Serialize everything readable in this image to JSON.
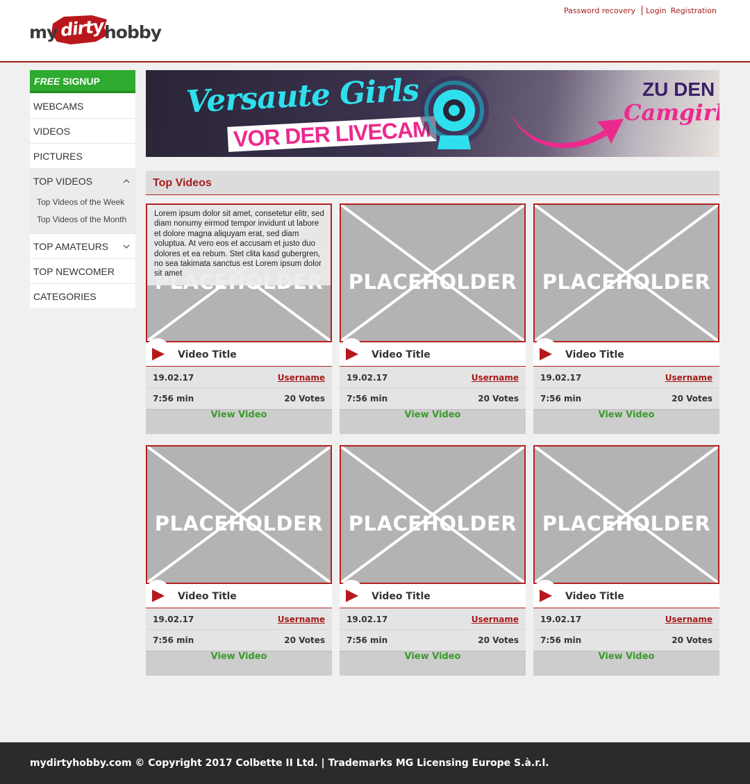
{
  "header": {
    "logo": {
      "part1": "my",
      "part2": "dirty",
      "part3": "hobby"
    },
    "links": {
      "password_recovery": "Password recovery",
      "login": "Login",
      "registration": "Registration"
    }
  },
  "sidebar": {
    "signup": {
      "free": "FREE",
      "signup": "SIGNUP"
    },
    "items": [
      {
        "label": "WEBCAMS"
      },
      {
        "label": "VIDEOS"
      },
      {
        "label": "PICTURES"
      },
      {
        "label": "TOP VIDEOS",
        "icon": "chevron-up-icon"
      },
      {
        "label": "TOP AMATEURS",
        "icon": "chevron-down-icon"
      },
      {
        "label": "TOP NEWCOMER"
      },
      {
        "label": "CATEGORIES"
      }
    ],
    "subitems": [
      "Top Videos of the Week",
      "Top Videos of the Month"
    ]
  },
  "banner": {
    "line1": "Versaute Girls",
    "line2": "VOR DER LIVECAM",
    "cta1": "ZU DEN",
    "cta2": "Camgirls"
  },
  "section": {
    "title": "Top Videos"
  },
  "videos": [
    {
      "placeholder": "PLACEHOLDER",
      "title": "Video Title",
      "date": "19.02.17",
      "user": "Username",
      "duration": "7:56 min",
      "votes": "20 Votes",
      "button": "View Video",
      "description": "Lorem ipsum dolor sit amet, consetetur elitr, sed diam nonumy eirmod tempor invidunt ut labore et dolore magna aliquyam erat, sed diam voluptua. At vero eos et accusam et justo duo dolores et ea rebum. Stet clita kasd gubergren, no sea takimata sanctus est Lorem ipsum dolor sit amet"
    },
    {
      "placeholder": "PLACEHOLDER",
      "title": "Video Title",
      "date": "19.02.17",
      "user": "Username",
      "duration": "7:56 min",
      "votes": "20 Votes",
      "button": "View Video"
    },
    {
      "placeholder": "PLACEHOLDER",
      "title": "Video Title",
      "date": "19.02.17",
      "user": "Username",
      "duration": "7:56 min",
      "votes": "20 Votes",
      "button": "View Video"
    },
    {
      "placeholder": "PLACEHOLDER",
      "title": "Video Title",
      "date": "19.02.17",
      "user": "Username",
      "duration": "7:56 min",
      "votes": "20 Votes",
      "button": "View Video"
    },
    {
      "placeholder": "PLACEHOLDER",
      "title": "Video Title",
      "date": "19.02.17",
      "user": "Username",
      "duration": "7:56 min",
      "votes": "20 Votes",
      "button": "View Video"
    },
    {
      "placeholder": "PLACEHOLDER",
      "title": "Video Title",
      "date": "19.02.17",
      "user": "Username",
      "duration": "7:56 min",
      "votes": "20 Votes",
      "button": "View Video"
    }
  ],
  "footer": {
    "text": "mydirtyhobby.com © Copyright 2017 Colbette II Ltd. | Trademarks MG Licensing Europe S.à.r.l."
  },
  "colors": {
    "brand_red": "#a51c1c",
    "signup_green": "#2eaa2e",
    "link_green": "#3a9a2c",
    "footer_bg": "#2b2b2b"
  }
}
